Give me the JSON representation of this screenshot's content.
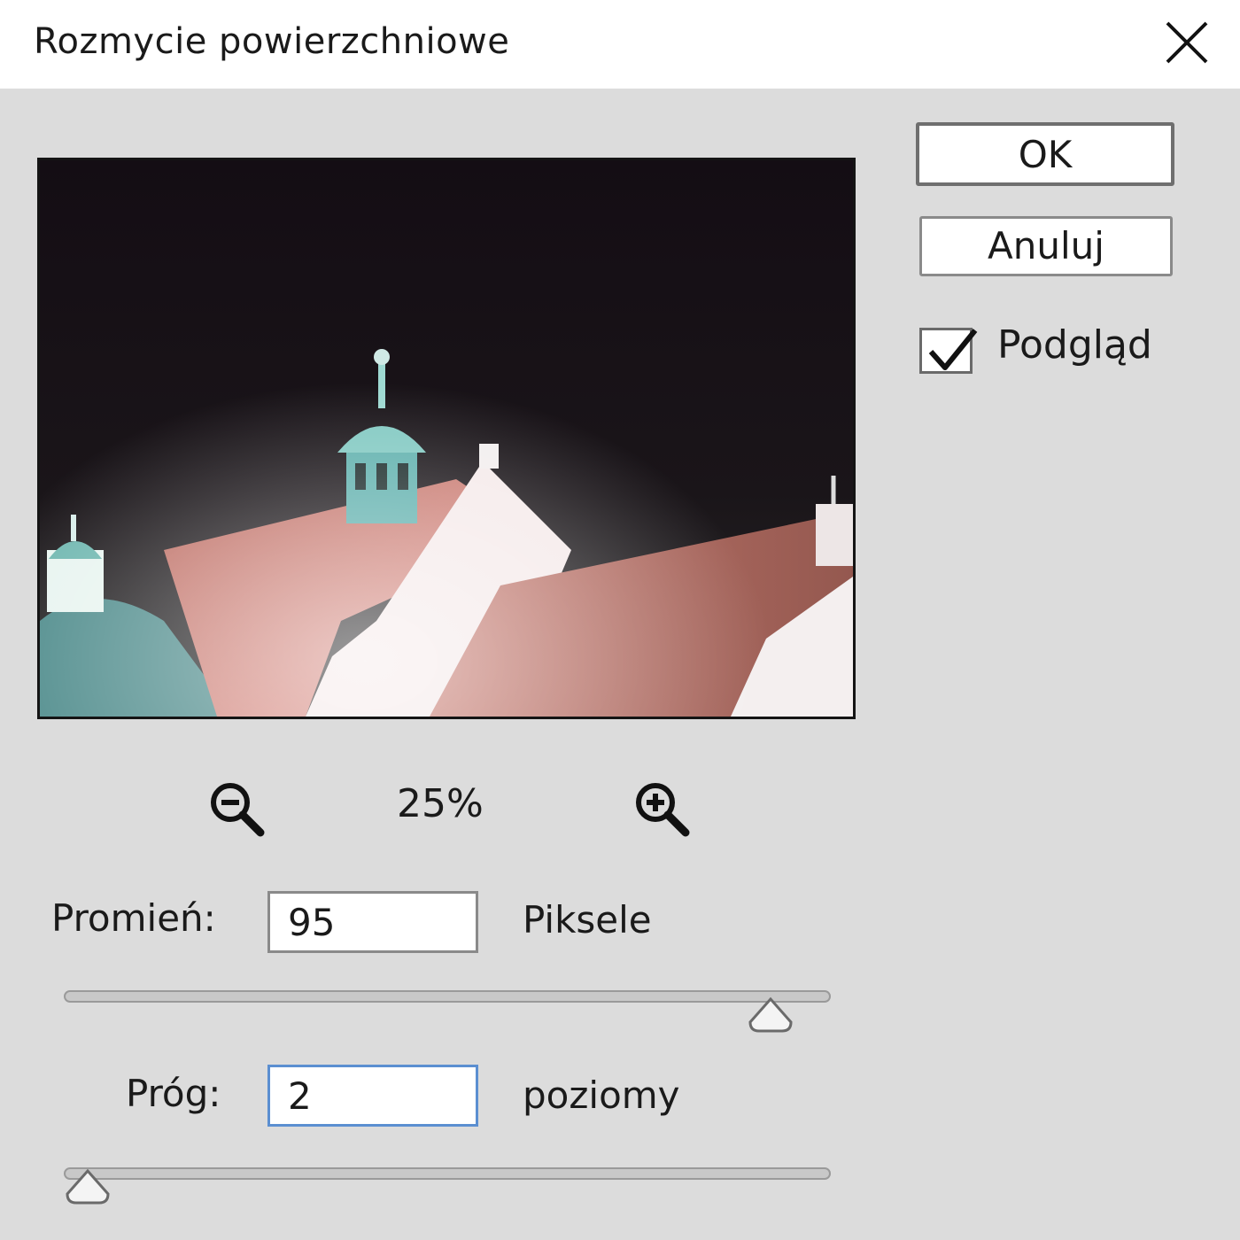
{
  "dialog": {
    "title": "Rozmycie powierzchniowe",
    "close_icon": "close-icon"
  },
  "buttons": {
    "ok_label": "OK",
    "cancel_label": "Anuluj"
  },
  "preview_toggle": {
    "label": "Podgląd",
    "checked": true
  },
  "zoom": {
    "level": "25%",
    "zoom_out_icon": "zoom-out-icon",
    "zoom_in_icon": "zoom-in-icon"
  },
  "radius": {
    "label": "Promień:",
    "value": "95",
    "unit": "Piksele",
    "slider_fraction": 0.95
  },
  "threshold": {
    "label": "Próg:",
    "value": "2",
    "unit": "poziomy",
    "slider_fraction": 0.0
  },
  "colors": {
    "dialog_bg": "#dcdcdc",
    "titlebar_bg": "#ffffff",
    "focus_border": "#5b8fd1"
  }
}
